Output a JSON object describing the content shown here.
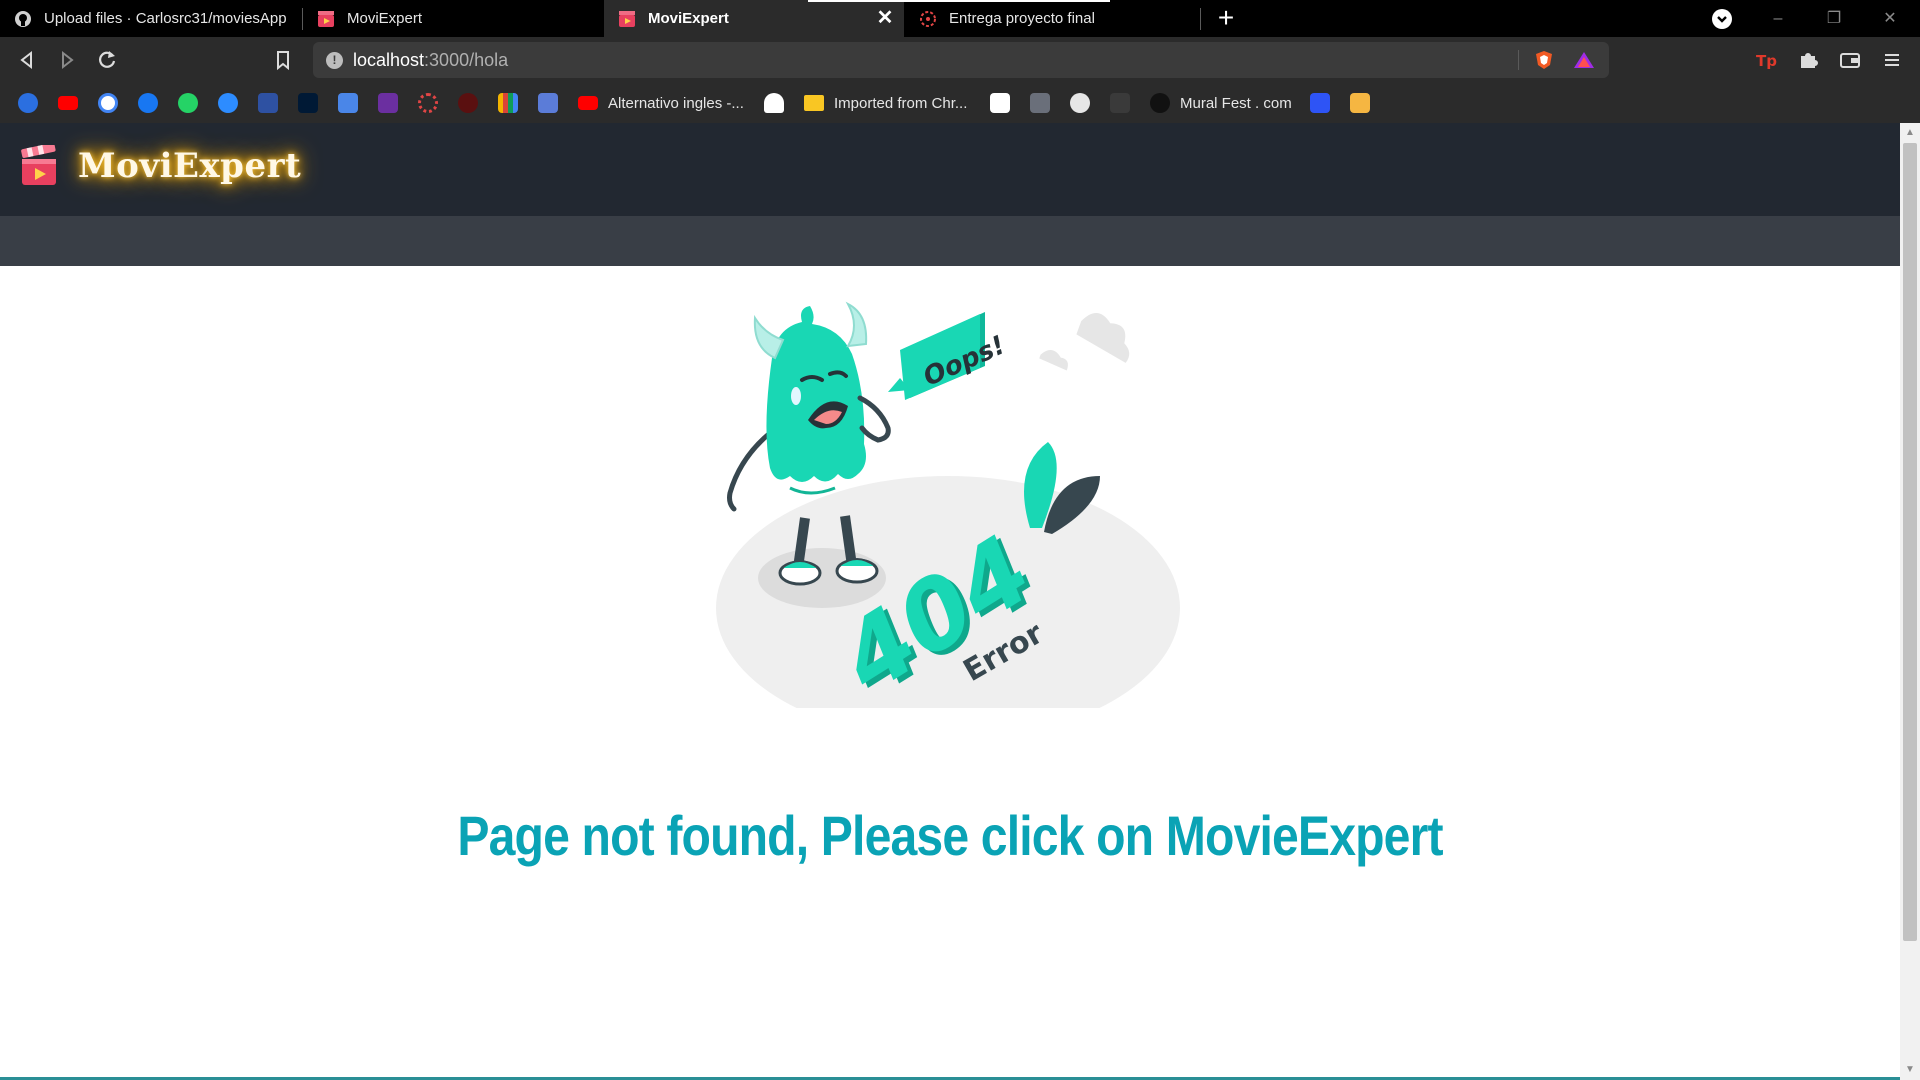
{
  "browser": {
    "tabs": [
      {
        "title": "Upload files · Carlosrc31/moviesApp",
        "icon": "github-icon",
        "active": false
      },
      {
        "title": "MoviExpert",
        "icon": "moviexpert-favicon",
        "active": false
      },
      {
        "title": "MoviExpert",
        "icon": "moviexpert-favicon",
        "active": true
      },
      {
        "title": "Entrega proyecto final",
        "icon": "platzi-favicon",
        "active": false
      }
    ],
    "tab_close": "✕",
    "new_tab": "+",
    "window_controls": {
      "minimize": "–",
      "restore": "❐",
      "close": "✕"
    },
    "url": {
      "host": "localhost",
      "path": ":3000/hola"
    },
    "bookmarks": [
      {
        "label": "Alternativo ingles -...",
        "icon": "youtube-icon"
      },
      {
        "label": "Imported from Chr...",
        "icon": "folder-icon"
      },
      {
        "label": "Mural Fest . com",
        "icon": "mural-fest-icon"
      }
    ],
    "colors": {
      "tabstrip": "#000000",
      "toolbar": "#2b2b2b",
      "omnibox": "#3b3b3b"
    }
  },
  "page": {
    "brand": {
      "name": "MoviExpert",
      "logo": "clapperboard-icon"
    },
    "illustration": {
      "speech_bubble": "Oops!",
      "digits": "404",
      "caption": "Error"
    },
    "message": "Page not found, Please click on MovieExpert",
    "colors": {
      "navbar": "#222831",
      "subbar": "#393e46",
      "message": "#0aa3b5",
      "monster": "#19d7b4"
    }
  }
}
